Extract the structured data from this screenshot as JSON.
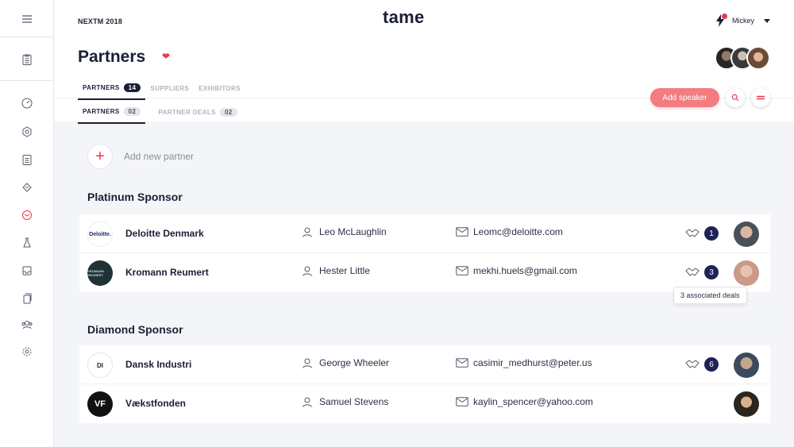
{
  "event": "NEXTM 2018",
  "app_name": "tame",
  "user": {
    "name": "Mickey"
  },
  "page_title": "Partners",
  "tabs": [
    {
      "label": "PARTNERS",
      "count": "14"
    },
    {
      "label": "SUPPLIERS"
    },
    {
      "label": "EXHIBITORS"
    }
  ],
  "subtabs": [
    {
      "label": "PARTNERS",
      "count": "02"
    },
    {
      "label": "PARTNER DEALS",
      "count": "02"
    }
  ],
  "actions": {
    "add_speaker": "Add speaker"
  },
  "add_partner_label": "Add new partner",
  "sections": [
    {
      "title": "Platinum Sponsor",
      "rows": [
        {
          "company": "Deloitte Denmark",
          "logo_text": "Deloitte.",
          "contact": "Leo McLaughlin",
          "email": "Leomc@deloitte.com",
          "deals": "1"
        },
        {
          "company": "Kromann Reumert",
          "logo_text": "KROMANN REUMERT",
          "contact": "Hester Little",
          "email": "mekhi.huels@gmail.com",
          "deals": "3"
        }
      ]
    },
    {
      "title": "Diamond Sponsor",
      "rows": [
        {
          "company": "Dansk Industri",
          "logo_text": "DI",
          "contact": "George Wheeler",
          "email": "casimir_medhurst@peter.us",
          "deals": "6"
        },
        {
          "company": "Vækstfonden",
          "logo_text": "VF",
          "contact": "Samuel Stevens",
          "email": "kaylin_spencer@yahoo.com"
        }
      ]
    }
  ],
  "tooltip": "3 associated deals",
  "colors": {
    "accent": "#e8374c",
    "navy": "#1a1f36",
    "button": "#f27c80",
    "deal_badge": "#1f2257"
  },
  "icons": [
    "menu-icon",
    "clipboard-icon",
    "dashboard-icon",
    "hexagon-icon",
    "ticket-icon",
    "partners-icon",
    "flask-icon",
    "inbox-icon",
    "copy-icon",
    "team-icon",
    "settings-icon",
    "bolt-icon",
    "search-icon",
    "menu-lines-icon",
    "user-icon",
    "mail-icon",
    "handshake-icon"
  ]
}
